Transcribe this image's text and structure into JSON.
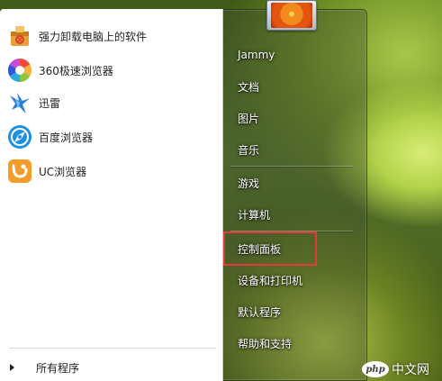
{
  "programs": [
    {
      "label": "强力卸载电脑上的软件",
      "icon": "uninstaller-icon"
    },
    {
      "label": "360极速浏览器",
      "icon": "360-browser-icon"
    },
    {
      "label": "迅雷",
      "icon": "thunder-icon"
    },
    {
      "label": "百度浏览器",
      "icon": "baidu-browser-icon"
    },
    {
      "label": "UC浏览器",
      "icon": "uc-browser-icon"
    }
  ],
  "all_programs": "所有程序",
  "right_items": [
    "Jammy",
    "文档",
    "图片",
    "音乐",
    "游戏",
    "计算机",
    "控制面板",
    "设备和打印机",
    "默认程序",
    "帮助和支持"
  ],
  "watermark": {
    "badge": "php",
    "text": "中文网"
  },
  "colors": {
    "highlight": "#e33b3b",
    "left_pane": "#ffffff"
  }
}
